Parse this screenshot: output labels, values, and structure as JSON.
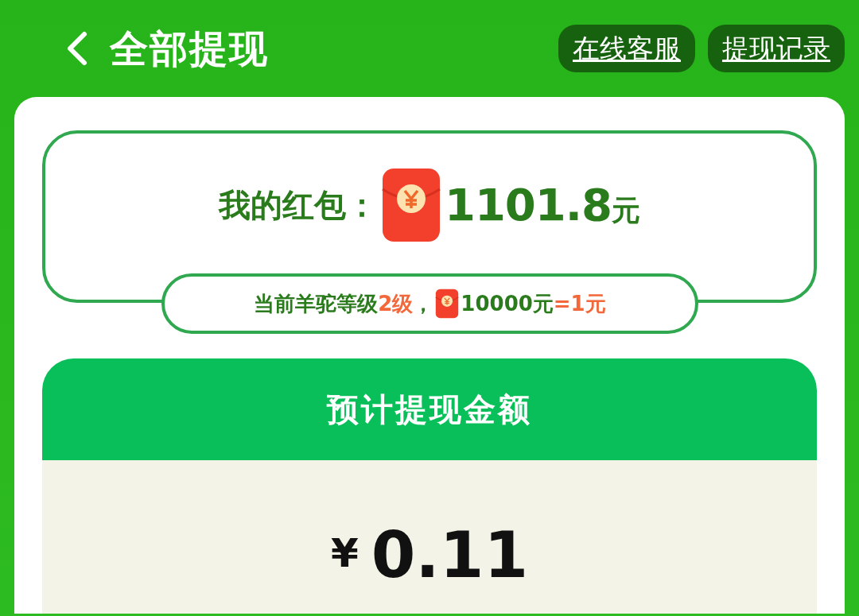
{
  "header": {
    "title": "全部提现",
    "buttons": [
      "在线客服",
      "提现记录"
    ]
  },
  "balance": {
    "label": "我的红包：",
    "amount": "1101.8",
    "unit": "元"
  },
  "rate": [
    {
      "text": "当前羊驼等级",
      "highlight": false
    },
    {
      "text": "2级",
      "highlight": true
    },
    {
      "text": "，",
      "highlight": false
    },
    {
      "kind": "icon"
    },
    {
      "text": "10000元",
      "highlight": false
    },
    {
      "text": "=1元",
      "highlight": true
    }
  ],
  "withdraw": {
    "title": "预计提现金额",
    "currency": "¥",
    "amount": "0.11"
  }
}
